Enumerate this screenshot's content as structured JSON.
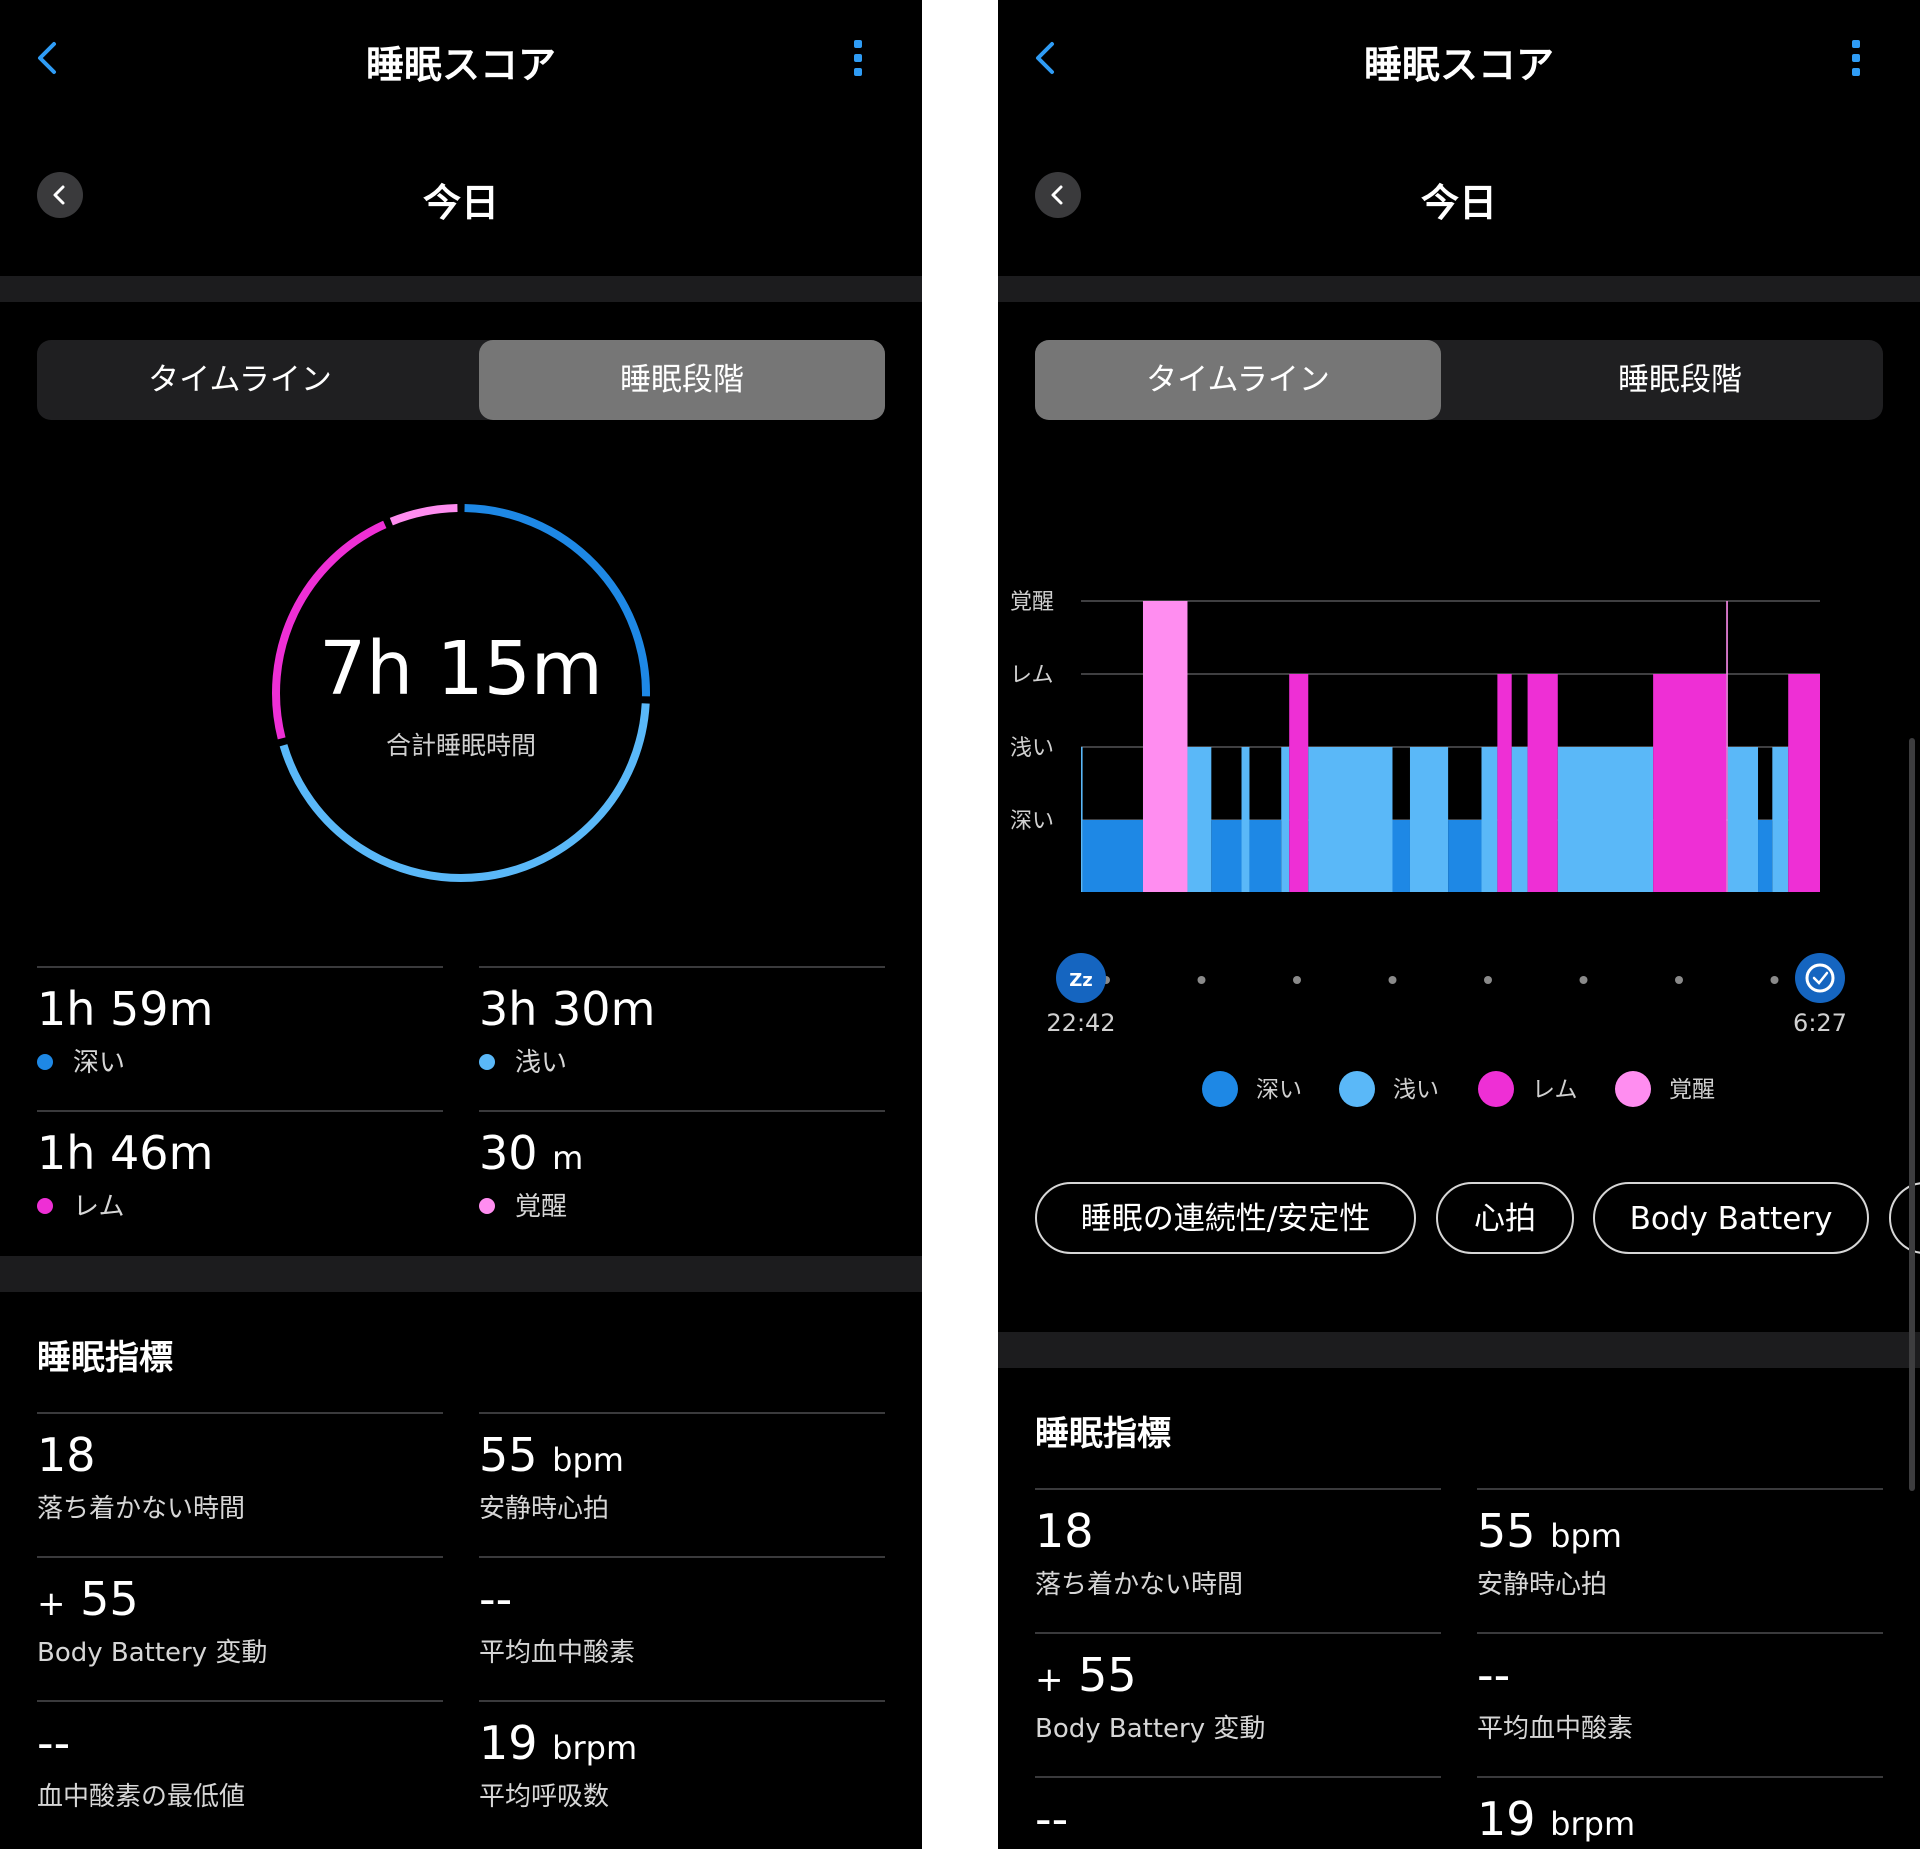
{
  "header": {
    "title": "睡眠スコア"
  },
  "date_nav": {
    "label": "今日"
  },
  "tabs": {
    "timeline": "タイムライン",
    "stages": "睡眠段階"
  },
  "ring": {
    "total": "7h 15m",
    "label": "合計睡眠時間"
  },
  "stage_summary": [
    {
      "key": "deep",
      "value": "1h 59m",
      "unit": "",
      "label": "深い",
      "color": "#1e88e5"
    },
    {
      "key": "light",
      "value": "3h 30m",
      "unit": "",
      "label": "浅い",
      "color": "#5ab8f8"
    },
    {
      "key": "rem",
      "value": "1h 46m",
      "unit": "",
      "label": "レム",
      "color": "#ee2fd5"
    },
    {
      "key": "awake",
      "value": "30",
      "unit": "m",
      "label": "覚醒",
      "color": "#ff8df0"
    }
  ],
  "metrics": {
    "title": "睡眠指標",
    "restless": {
      "value": "18",
      "label": "落ち着かない時間"
    },
    "resting_hr": {
      "value": "55",
      "unit": "bpm",
      "label": "安静時心拍"
    },
    "body_battery": {
      "prefix": "+",
      "value": "55",
      "label": "Body Battery 変動"
    },
    "avg_spo2": {
      "value": "--",
      "label": "平均血中酸素"
    },
    "min_spo2": {
      "value": "--",
      "label": "血中酸素の最低値"
    },
    "resp": {
      "value": "19",
      "unit": "brpm",
      "label": "平均呼吸数"
    }
  },
  "chart_data": {
    "type": "bar",
    "y_levels": [
      "深い",
      "浅い",
      "レム",
      "覚醒"
    ],
    "start_label": "22:42",
    "end_label": "6:27",
    "start_min": 0,
    "end_min": 465,
    "colors": {
      "深い": "#1e88e5",
      "浅い": "#5ab8f8",
      "レム": "#ee2fd5",
      "覚醒": "#ff8df0"
    },
    "segments": [
      {
        "start": 0,
        "end": 1,
        "stage": "浅い"
      },
      {
        "start": 1,
        "end": 39,
        "stage": "深い"
      },
      {
        "start": 39,
        "end": 67,
        "stage": "覚醒"
      },
      {
        "start": 67,
        "end": 82,
        "stage": "浅い"
      },
      {
        "start": 82,
        "end": 101,
        "stage": "深い"
      },
      {
        "start": 101,
        "end": 106,
        "stage": "浅い"
      },
      {
        "start": 106,
        "end": 126,
        "stage": "深い"
      },
      {
        "start": 126,
        "end": 131,
        "stage": "浅い"
      },
      {
        "start": 131,
        "end": 143,
        "stage": "レム"
      },
      {
        "start": 143,
        "end": 196,
        "stage": "浅い"
      },
      {
        "start": 196,
        "end": 207,
        "stage": "深い"
      },
      {
        "start": 207,
        "end": 231,
        "stage": "浅い"
      },
      {
        "start": 231,
        "end": 252,
        "stage": "深い"
      },
      {
        "start": 252,
        "end": 262,
        "stage": "浅い"
      },
      {
        "start": 262,
        "end": 271,
        "stage": "レム"
      },
      {
        "start": 271,
        "end": 281,
        "stage": "浅い"
      },
      {
        "start": 281,
        "end": 300,
        "stage": "レム"
      },
      {
        "start": 300,
        "end": 360,
        "stage": "浅い"
      },
      {
        "start": 360,
        "end": 406,
        "stage": "レム"
      },
      {
        "start": 406,
        "end": 407,
        "stage": "覚醒"
      },
      {
        "start": 407,
        "end": 426,
        "stage": "浅い"
      },
      {
        "start": 426,
        "end": 435,
        "stage": "深い"
      },
      {
        "start": 435,
        "end": 445,
        "stage": "浅い"
      },
      {
        "start": 445,
        "end": 465,
        "stage": "レム"
      }
    ]
  },
  "legend": [
    "深い",
    "浅い",
    "レム",
    "覚醒"
  ],
  "pills": [
    "睡眠の連続性/安定性",
    "心拍",
    "Body Battery"
  ]
}
